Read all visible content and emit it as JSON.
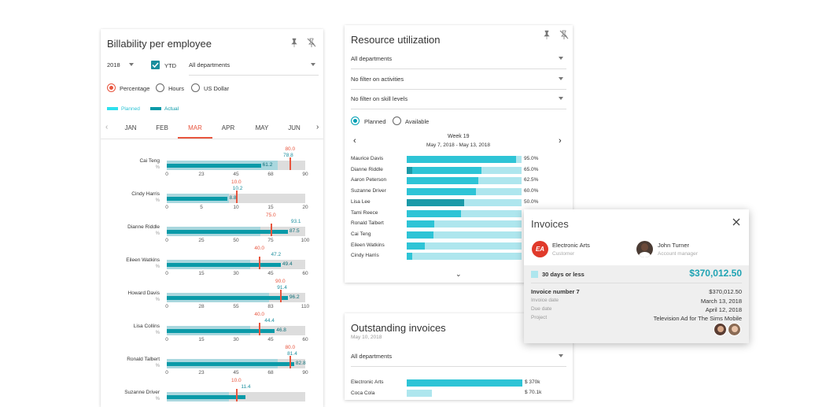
{
  "billability": {
    "title": "Billability per employee",
    "year": "2018",
    "ytd_label": "YTD",
    "department": "All departments",
    "radios": [
      "Percentage",
      "Hours",
      "US Dollar"
    ],
    "legend": {
      "planned": "Planned",
      "actual": "Actual"
    },
    "months": [
      "JAN",
      "FEB",
      "MAR",
      "APR",
      "MAY",
      "JUN"
    ],
    "active_month": "MAR",
    "employees": [
      {
        "name": "Cai Teng",
        "unit": "%",
        "planned": "80.0",
        "actual": "78.8",
        "actual2": "61.2",
        "ticks": [
          "0",
          "23",
          "45",
          "68",
          "90"
        ]
      },
      {
        "name": "Cindy Harris",
        "unit": "%",
        "planned": "10.0",
        "actual": "10.2",
        "actual2": "8.8",
        "ticks": [
          "0",
          "5",
          "10",
          "15",
          "20"
        ]
      },
      {
        "name": "Dianne Riddle",
        "unit": "%",
        "planned": "75.0",
        "actual": "93.1",
        "actual2": "87.5",
        "ticks": [
          "0",
          "25",
          "50",
          "75",
          "100"
        ]
      },
      {
        "name": "Eileen Watkins",
        "unit": "%",
        "planned": "40.0",
        "actual": "47.2",
        "actual2": "49.4",
        "ticks": [
          "0",
          "15",
          "30",
          "45",
          "60"
        ]
      },
      {
        "name": "Howard Davis",
        "unit": "%",
        "planned": "90.0",
        "actual": "91.4",
        "actual2": "96.2",
        "ticks": [
          "0",
          "28",
          "55",
          "83",
          "110"
        ]
      },
      {
        "name": "Lisa Collins",
        "unit": "%",
        "planned": "40.0",
        "actual": "44.4",
        "actual2": "46.8",
        "ticks": [
          "0",
          "15",
          "30",
          "45",
          "60"
        ]
      },
      {
        "name": "Ronald Talbert",
        "unit": "%",
        "planned": "80.0",
        "actual": "81.4",
        "actual2": "82.8",
        "ticks": [
          "0",
          "23",
          "45",
          "68",
          "90"
        ]
      },
      {
        "name": "Suzanne Driver",
        "unit": "%",
        "planned": "10.0",
        "actual": "11.4",
        "actual2": "",
        "ticks": []
      }
    ]
  },
  "resource": {
    "title": "Resource utilization",
    "filters": [
      "All departments",
      "No filter on activities",
      "No filter on skill levels"
    ],
    "radios": [
      "Planned",
      "Available"
    ],
    "week": "Week 19",
    "range": "May 7, 2018 - May 13, 2018",
    "rows": [
      {
        "name": "Maurice Davis",
        "pct": "95.0%",
        "value": 95.0
      },
      {
        "name": "Dianne Riddle",
        "pct": "65.0%",
        "value": 65.0
      },
      {
        "name": "Aaron Peterson",
        "pct": "62.5%",
        "value": 62.5
      },
      {
        "name": "Suzanne Driver",
        "pct": "60.0%",
        "value": 60.0
      },
      {
        "name": "Lisa Lee",
        "pct": "50.0%",
        "value": 50.0
      },
      {
        "name": "Tami Reece",
        "pct": "",
        "value": 47
      },
      {
        "name": "Ronald Talbert",
        "pct": "",
        "value": 24
      },
      {
        "name": "Cai Teng",
        "pct": "",
        "value": 23
      },
      {
        "name": "Eileen Watkins",
        "pct": "",
        "value": 16
      },
      {
        "name": "Cindy Harris",
        "pct": "",
        "value": 5
      }
    ]
  },
  "outstanding": {
    "title": "Outstanding invoices",
    "date": "May 10, 2018",
    "department": "All departments",
    "rows": [
      {
        "name": "Electronic Arts",
        "amount": "$ 370k"
      },
      {
        "name": "Coca Cola",
        "amount": "$ 70.1k"
      }
    ]
  },
  "invoices": {
    "title": "Invoices",
    "customer": {
      "name": "Electronic Arts",
      "role": "Customer",
      "logo": "EA"
    },
    "manager": {
      "name": "John Turner",
      "role": "Account manager"
    },
    "bucket": "30 days or less",
    "total": "$370,012.50",
    "invoice_number": "Invoice number 7",
    "invoice_amount": "$370,012.50",
    "fields": [
      {
        "label": "Invoice date",
        "value": "March 13, 2018"
      },
      {
        "label": "Due date",
        "value": "April 12, 2018"
      },
      {
        "label": "Project",
        "value": "Television Ad for The Sims Mobile"
      }
    ]
  }
}
